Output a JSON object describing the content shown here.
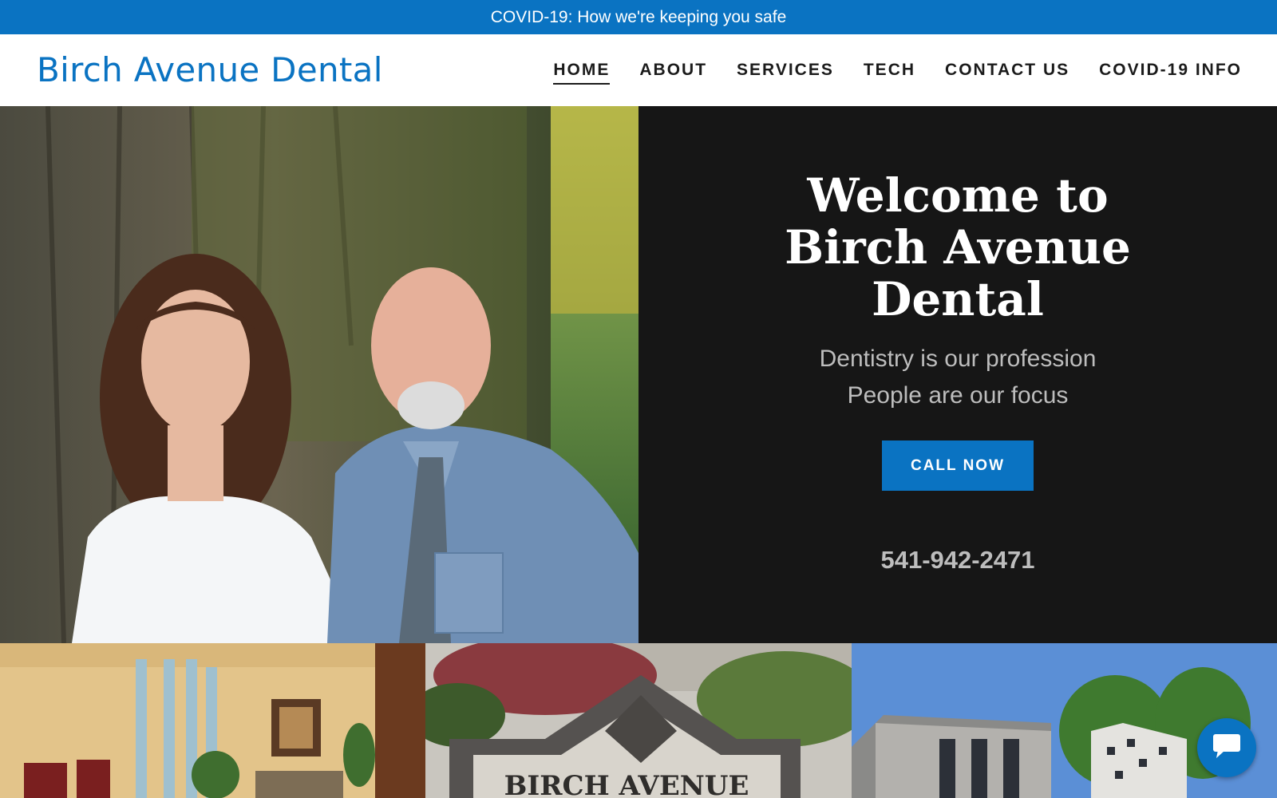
{
  "banner": {
    "text": "COVID-19: How we're keeping you safe"
  },
  "header": {
    "logo": "Birch Avenue Dental",
    "nav": [
      "HOME",
      "ABOUT",
      "SERVICES",
      "TECH",
      "CONTACT US",
      "COVID-19 INFO"
    ],
    "active_nav": "HOME"
  },
  "hero": {
    "title_lines": [
      "Welcome to",
      "Birch Avenue",
      "Dental"
    ],
    "tagline_1": "Dentistry is our profession",
    "tagline_2": "People are our focus",
    "cta_label": "CALL NOW",
    "phone": "541-942-2471"
  },
  "gallery": {
    "sign_text": "BIRCH AVENUE"
  },
  "colors": {
    "brand": "#0a73c2",
    "hero_bg": "#161616",
    "muted_text": "#bdbdbd"
  },
  "icons": {
    "chat": "chat-bubble-icon"
  }
}
